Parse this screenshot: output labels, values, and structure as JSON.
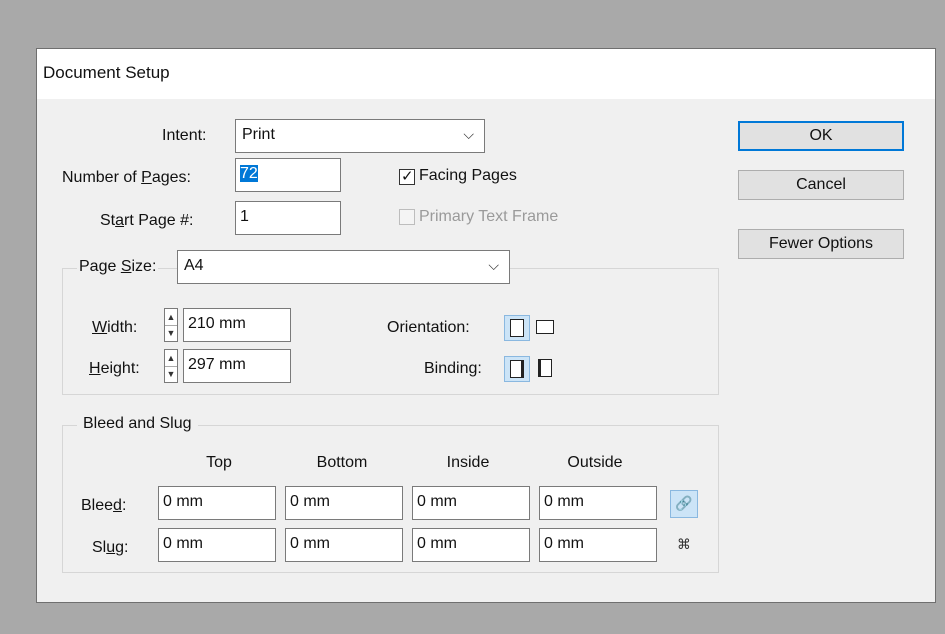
{
  "dialog": {
    "title": "Document Setup"
  },
  "intent": {
    "label": "Intent:",
    "value": "Print"
  },
  "pages": {
    "label_pre": "Number of ",
    "label_u": "P",
    "label_post": "ages:",
    "value": "72"
  },
  "start_page": {
    "label_pre": "St",
    "label_u": "a",
    "label_post": "rt Page #:",
    "value": "1"
  },
  "facing_pages": {
    "label": "Facing Pages",
    "checked": true
  },
  "primary_text_frame": {
    "label": "Primary Text Frame",
    "checked": false,
    "disabled": true
  },
  "buttons": {
    "ok": "OK",
    "cancel": "Cancel",
    "fewer": "Fewer Options"
  },
  "page_size": {
    "label_pre": "Page ",
    "label_u": "S",
    "label_post": "ize:",
    "value": "A4"
  },
  "width": {
    "label_u": "W",
    "label_post": "idth:",
    "value": "210 mm"
  },
  "height": {
    "label_u": "H",
    "label_post": "eight:",
    "value": "297 mm"
  },
  "orientation": {
    "label": "Orientation:"
  },
  "binding": {
    "label": "Binding:"
  },
  "bleed_slug": {
    "title": "Bleed and Slug",
    "columns": [
      "Top",
      "Bottom",
      "Inside",
      "Outside"
    ],
    "bleed": {
      "label_pre": "Blee",
      "label_u": "d",
      "label_post": ":",
      "values": [
        "0 mm",
        "0 mm",
        "0 mm",
        "0 mm"
      ]
    },
    "slug": {
      "label_pre": "Sl",
      "label_u": "u",
      "label_post": "g:",
      "values": [
        "0 mm",
        "0 mm",
        "0 mm",
        "0 mm"
      ]
    }
  },
  "colors": {
    "accent": "#0078d7",
    "active_icon_bg": "#cce4f7"
  }
}
